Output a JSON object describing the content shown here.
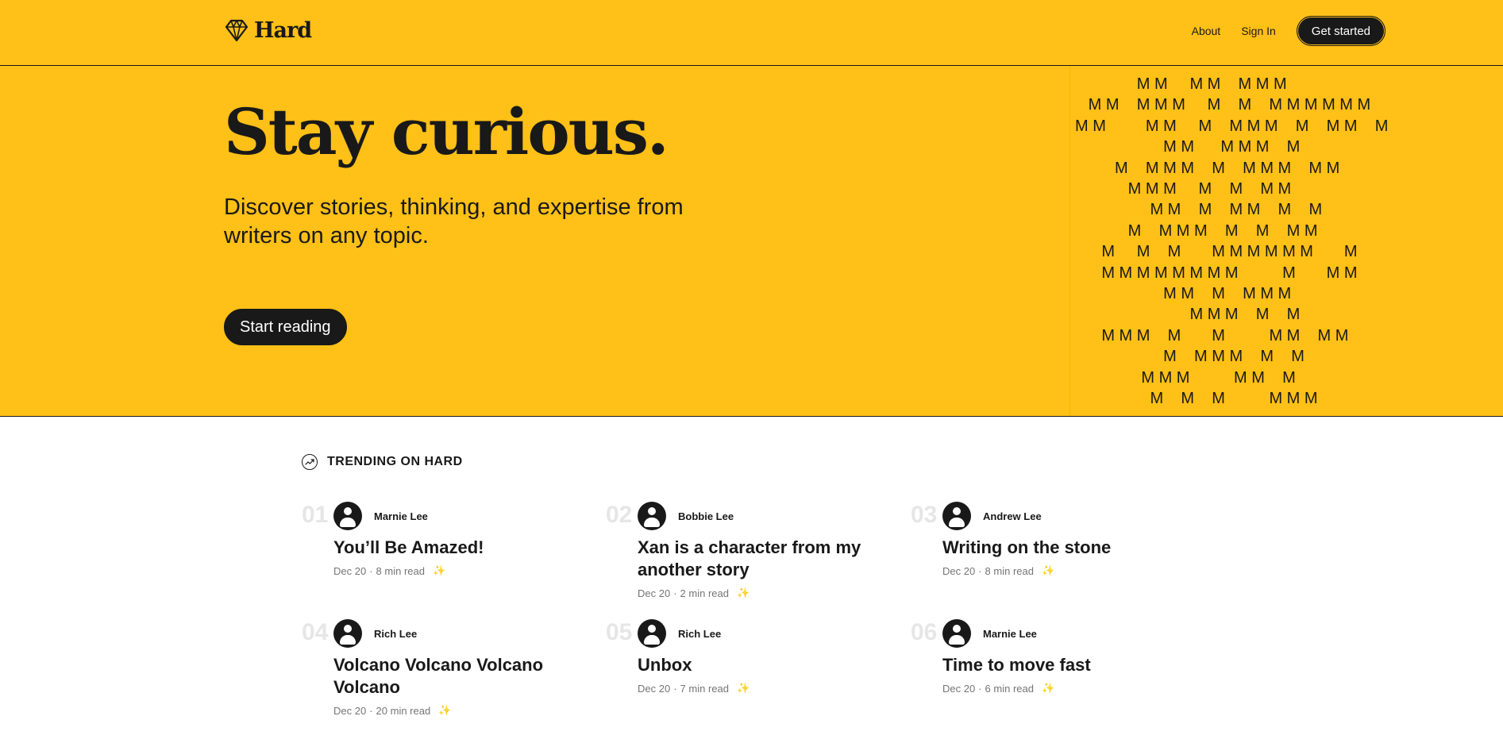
{
  "header": {
    "brand": "Hard",
    "nav": {
      "about": "About",
      "sign_in": "Sign In",
      "get_started": "Get started"
    }
  },
  "hero": {
    "title": "Stay curious.",
    "subtitle": "Discover stories, thinking, and expertise from writers on any topic.",
    "cta": "Start reading",
    "pattern_rows": [
      "              M M     M M    M M M",
      "   M M    M M M     M    M    M M M M M M",
      "M M         M M     M    M M M    M    M M    M",
      "                    M M      M M M    M",
      "         M    M M M    M    M M M    M M",
      "            M M M     M    M    M M",
      "                 M M    M    M M    M    M",
      "            M    M M M    M    M    M M",
      "      M     M    M       M M M M M M       M",
      "      M M M M M M M M          M       M M",
      "                    M M    M    M M M",
      "                          M M M    M    M",
      "      M M M    M       M          M M    M M",
      "                    M    M M M    M    M",
      "               M M M          M M    M",
      "                 M    M    M          M M M"
    ]
  },
  "trending": {
    "heading": "TRENDING ON HARD",
    "posts": [
      {
        "num": "01",
        "author": "Marnie Lee",
        "title": "You’ll Be Amazed!",
        "date": "Dec 20",
        "read": "8 min read"
      },
      {
        "num": "02",
        "author": "Bobbie Lee",
        "title": "Xan is a character from my another story",
        "date": "Dec 20",
        "read": "2 min read"
      },
      {
        "num": "03",
        "author": "Andrew Lee",
        "title": "Writing on the stone",
        "date": "Dec 20",
        "read": "8 min read"
      },
      {
        "num": "04",
        "author": "Rich Lee",
        "title": "Volcano Volcano Volcano Volcano",
        "date": "Dec 20",
        "read": "20 min read"
      },
      {
        "num": "05",
        "author": "Rich Lee",
        "title": "Unbox",
        "date": "Dec 20",
        "read": "7 min read"
      },
      {
        "num": "06",
        "author": "Marnie Lee",
        "title": "Time to move fast",
        "date": "Dec 20",
        "read": "6 min read"
      }
    ],
    "meta_separator": "·",
    "sparkle_icon": "sparkle-icon"
  }
}
